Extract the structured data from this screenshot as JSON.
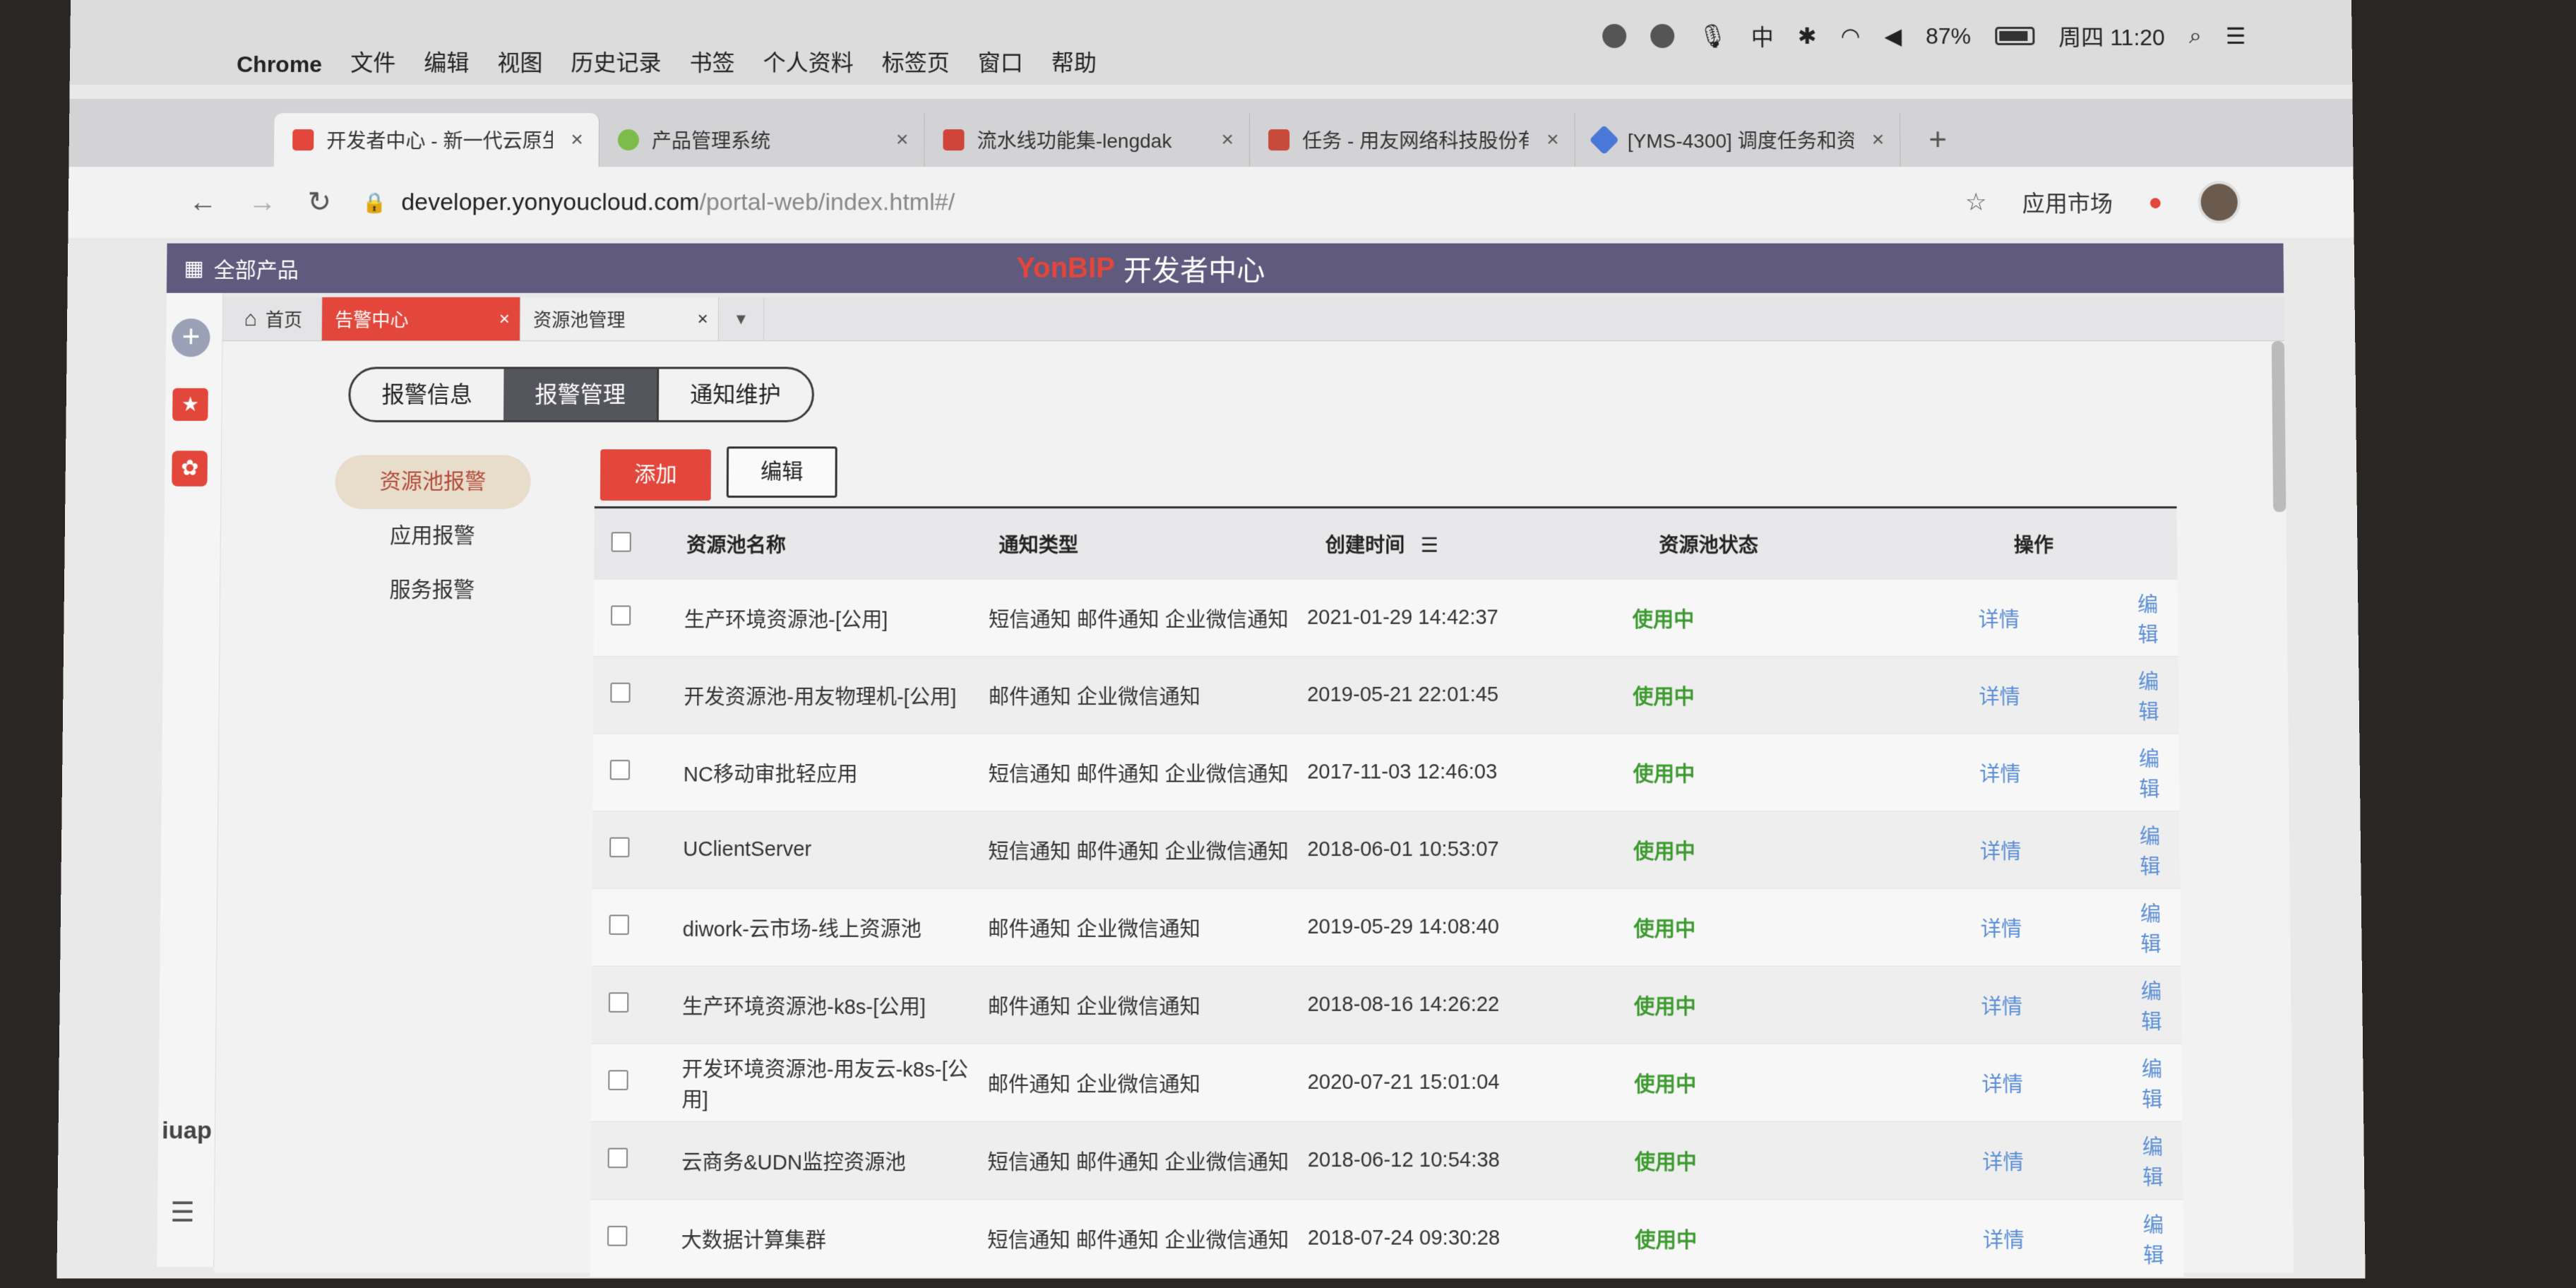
{
  "menubar": {
    "items": [
      "Chrome",
      "文件",
      "编辑",
      "视图",
      "历史记录",
      "书签",
      "个人资料",
      "标签页",
      "窗口",
      "帮助"
    ],
    "status": {
      "input_method": "中",
      "battery": "87%",
      "clock": "周四 11:20"
    }
  },
  "browser": {
    "tabs": [
      {
        "title": "开发者中心 - 新一代云原生",
        "color": "#e3463a"
      },
      {
        "title": "产品管理系统",
        "color": "#7dbb4a"
      },
      {
        "title": "流水线功能集-lengdak",
        "color": "#d0453a"
      },
      {
        "title": "任务 - 用友网络科技股份有",
        "color": "#c84a3a"
      },
      {
        "title": "[YMS-4300] 调度任务和资",
        "color": "#4a78d8"
      }
    ],
    "url_host": "developer.yonyoucloud.com",
    "url_path": "/portal-web/index.html#/",
    "market": "应用市场"
  },
  "app": {
    "all_products": "全部产品",
    "brand_logo": "YonBIP",
    "brand_title": "开发者中心",
    "rail_logo": "iuap"
  },
  "page_tabs": {
    "home": "首页",
    "alarm": "告警中心",
    "pool": "资源池管理"
  },
  "segments": [
    "报警信息",
    "报警管理",
    "通知维护"
  ],
  "side_nav": [
    "资源池报警",
    "应用报警",
    "服务报警"
  ],
  "buttons": {
    "add": "添加",
    "edit": "编辑"
  },
  "table": {
    "headers": {
      "name": "资源池名称",
      "type": "通知类型",
      "time": "创建时间",
      "state": "资源池状态",
      "ops": "操作"
    },
    "detail_label": "详情",
    "edit_label": "编辑",
    "rows": [
      {
        "name": "生产环境资源池-[公用]",
        "type": "短信通知 邮件通知 企业微信通知",
        "time": "2021-01-29 14:42:37",
        "state": "使用中"
      },
      {
        "name": "开发资源池-用友物理机-[公用]",
        "type": "邮件通知 企业微信通知",
        "time": "2019-05-21 22:01:45",
        "state": "使用中"
      },
      {
        "name": "NC移动审批轻应用",
        "type": "短信通知 邮件通知 企业微信通知",
        "time": "2017-11-03 12:46:03",
        "state": "使用中"
      },
      {
        "name": "UClientServer",
        "type": "短信通知 邮件通知 企业微信通知",
        "time": "2018-06-01 10:53:07",
        "state": "使用中"
      },
      {
        "name": "diwork-云市场-线上资源池",
        "type": "邮件通知 企业微信通知",
        "time": "2019-05-29 14:08:40",
        "state": "使用中"
      },
      {
        "name": "生产环境资源池-k8s-[公用]",
        "type": "邮件通知 企业微信通知",
        "time": "2018-08-16 14:26:22",
        "state": "使用中"
      },
      {
        "name": "开发环境资源池-用友云-k8s-[公用]",
        "type": "邮件通知 企业微信通知",
        "time": "2020-07-21 15:01:04",
        "state": "使用中"
      },
      {
        "name": "云商务&UDN监控资源池",
        "type": "短信通知 邮件通知 企业微信通知",
        "time": "2018-06-12 10:54:38",
        "state": "使用中"
      },
      {
        "name": "大数据计算集群",
        "type": "短信通知 邮件通知 企业微信通知",
        "time": "2018-07-24 09:30:28",
        "state": "使用中"
      }
    ]
  },
  "colors": {
    "accent": "#e3463a",
    "header": "#5f5a7e",
    "ok": "#3c9a2e",
    "link": "#5b8ed6"
  }
}
